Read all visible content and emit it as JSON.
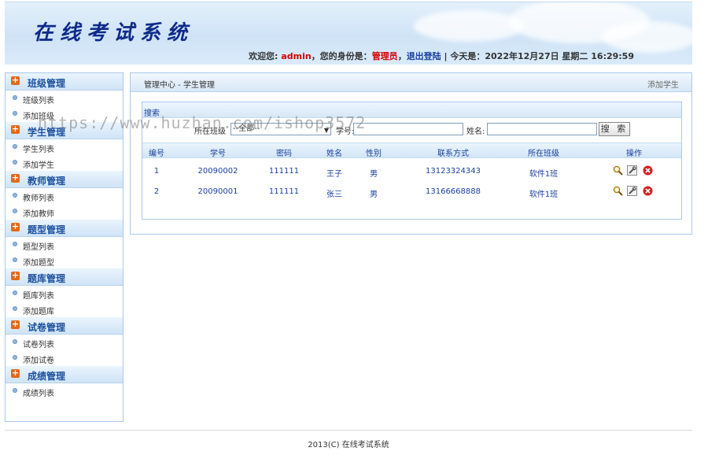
{
  "header": {
    "site_title": "在线考试系统",
    "welcome": "欢迎您:",
    "username": "admin",
    "role_prefix": "，您的身份是：",
    "role": "管理员",
    "logout": "退出登陆",
    "date_prefix": " | 今天是：",
    "date": "2022年12月27日 星期二 16:29:59"
  },
  "sidebar": {
    "groups": [
      {
        "title": "班级管理",
        "items": [
          "班级列表",
          "添加班级"
        ]
      },
      {
        "title": "学生管理",
        "items": [
          "学生列表",
          "添加学生"
        ]
      },
      {
        "title": "教师管理",
        "items": [
          "教师列表",
          "添加教师"
        ]
      },
      {
        "title": "题型管理",
        "items": [
          "题型列表",
          "添加题型"
        ]
      },
      {
        "title": "题库管理",
        "items": [
          "题库列表",
          "添加题库"
        ]
      },
      {
        "title": "试卷管理",
        "items": [
          "试卷列表",
          "添加试卷"
        ]
      },
      {
        "title": "成绩管理",
        "items": [
          "成绩列表"
        ]
      }
    ]
  },
  "main": {
    "breadcrumb": "管理中心 - 学生管理",
    "add_link": "添加学生",
    "search": {
      "title": "搜索",
      "class_label": "所在班级",
      "class_value": "--全部--",
      "number_label": "学号:",
      "name_label": "姓名:",
      "button": "搜 索"
    },
    "table": {
      "headers": [
        "编号",
        "学号",
        "密码",
        "姓名",
        "性别",
        "联系方式",
        "所在班级",
        "操作"
      ],
      "rows": [
        [
          "1",
          "20090002",
          "111111",
          "王子",
          "男",
          "13123324343",
          "软件1班"
        ],
        [
          "2",
          "20090001",
          "111111",
          "张三",
          "男",
          "13166668888",
          "软件1班"
        ]
      ]
    }
  },
  "watermark": "https://www.huzhan.com/ishop3572",
  "footer": "2013(C) 在线考试系统"
}
